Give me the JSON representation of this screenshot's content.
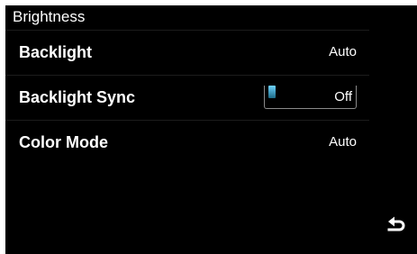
{
  "header": {
    "title": "Brightness"
  },
  "settings": [
    {
      "label": "Backlight",
      "value": "Auto"
    },
    {
      "label": "Backlight Sync",
      "value": "Off",
      "control": "toggle"
    },
    {
      "label": "Color Mode",
      "value": "Auto"
    }
  ],
  "footer": {
    "back_icon": "return-arrow-icon"
  },
  "colors": {
    "background": "#000000",
    "text": "#ffffff",
    "toggle_accent": "#4fb8e8",
    "toggle_outline": "#8a8a8a"
  }
}
